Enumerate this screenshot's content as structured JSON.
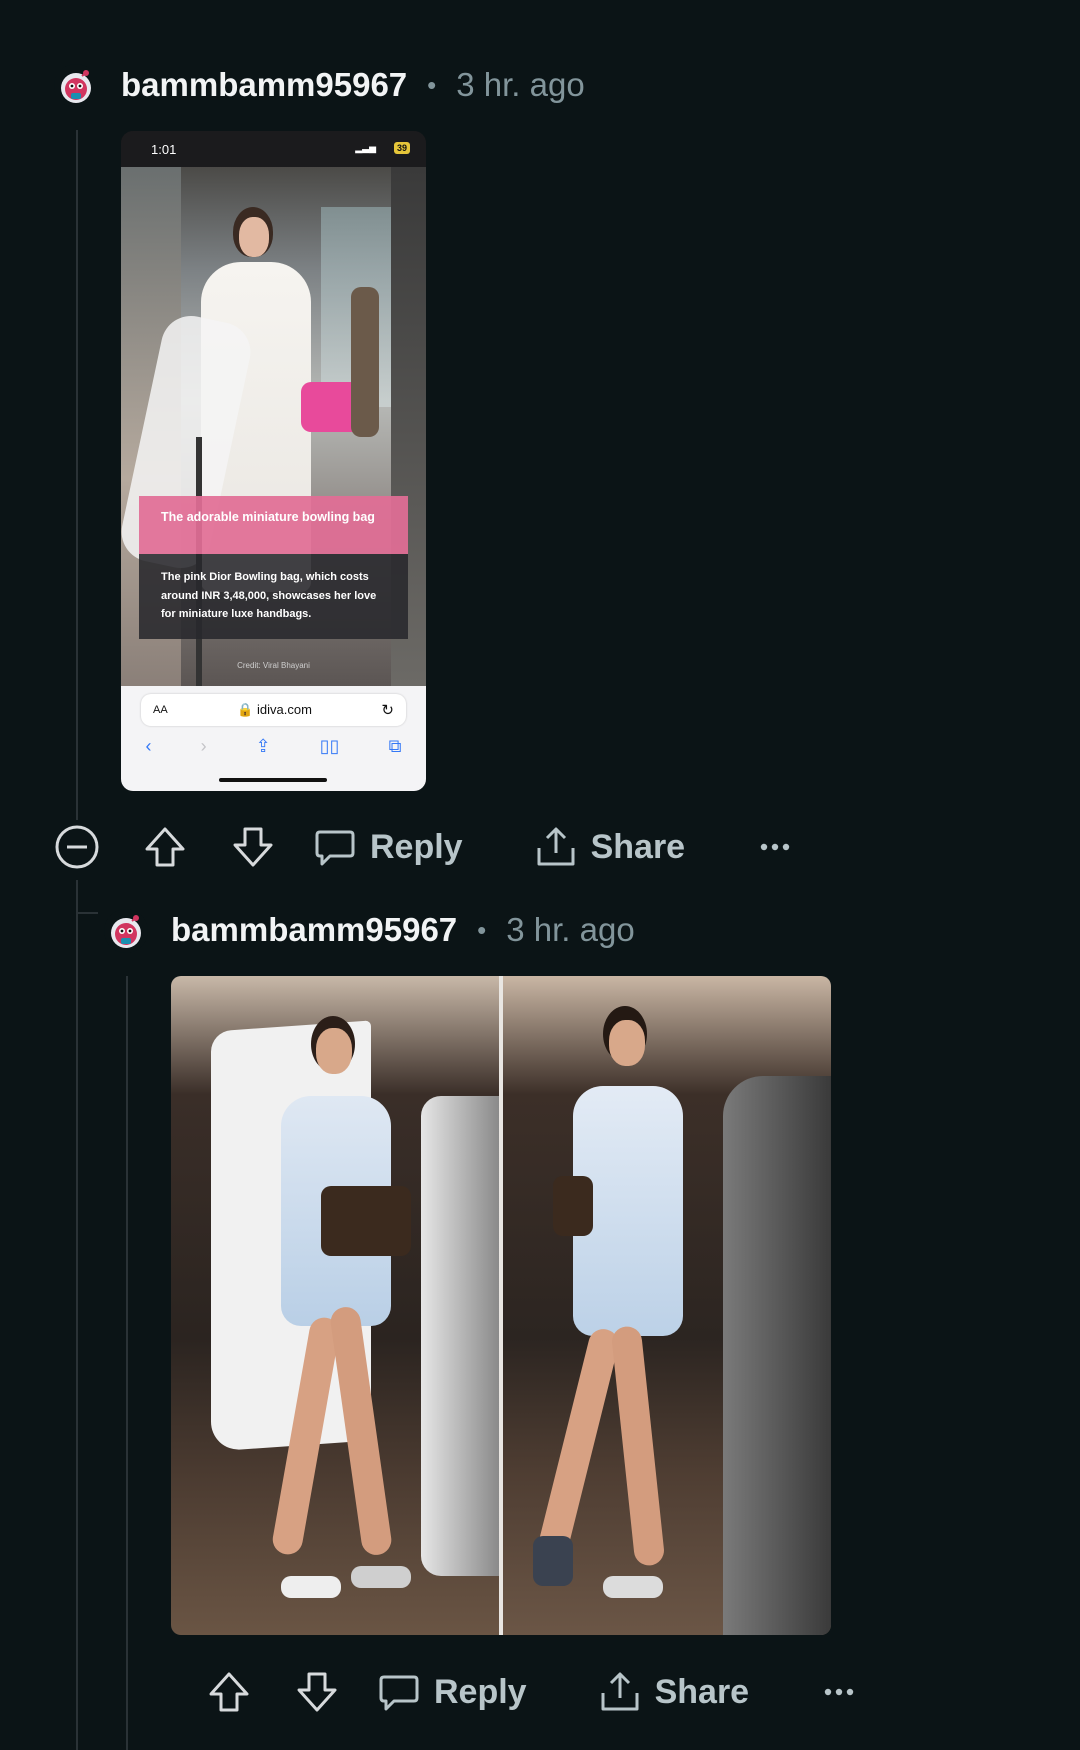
{
  "comments": [
    {
      "author": "bammbamm95967",
      "separator": "•",
      "time": "3 hr. ago",
      "image": {
        "status_time": "1:01",
        "battery": "39",
        "overlay_title": "The adorable miniature bowling bag",
        "overlay_body": "The pink Dior Bowling bag, which costs around INR 3,48,000, showcases her love for miniature luxe handbags.",
        "credit": "Credit: Viral Bhayani",
        "aa_label": "AA",
        "url": "idiva.com"
      },
      "actions": {
        "reply": "Reply",
        "share": "Share"
      }
    },
    {
      "author": "bammbamm95967",
      "separator": "•",
      "time": "3 hr. ago",
      "actions": {
        "reply": "Reply",
        "share": "Share"
      }
    }
  ],
  "colors": {
    "background": "#0b1416",
    "text_primary": "#f2f4f5",
    "text_secondary": "#82959b",
    "action_text": "#b8c5c9",
    "pink_overlay": "#e16e96"
  },
  "icons": [
    "avatar-icon",
    "collapse-icon",
    "upvote-icon",
    "downvote-icon",
    "reply-icon",
    "share-icon",
    "more-icon"
  ]
}
